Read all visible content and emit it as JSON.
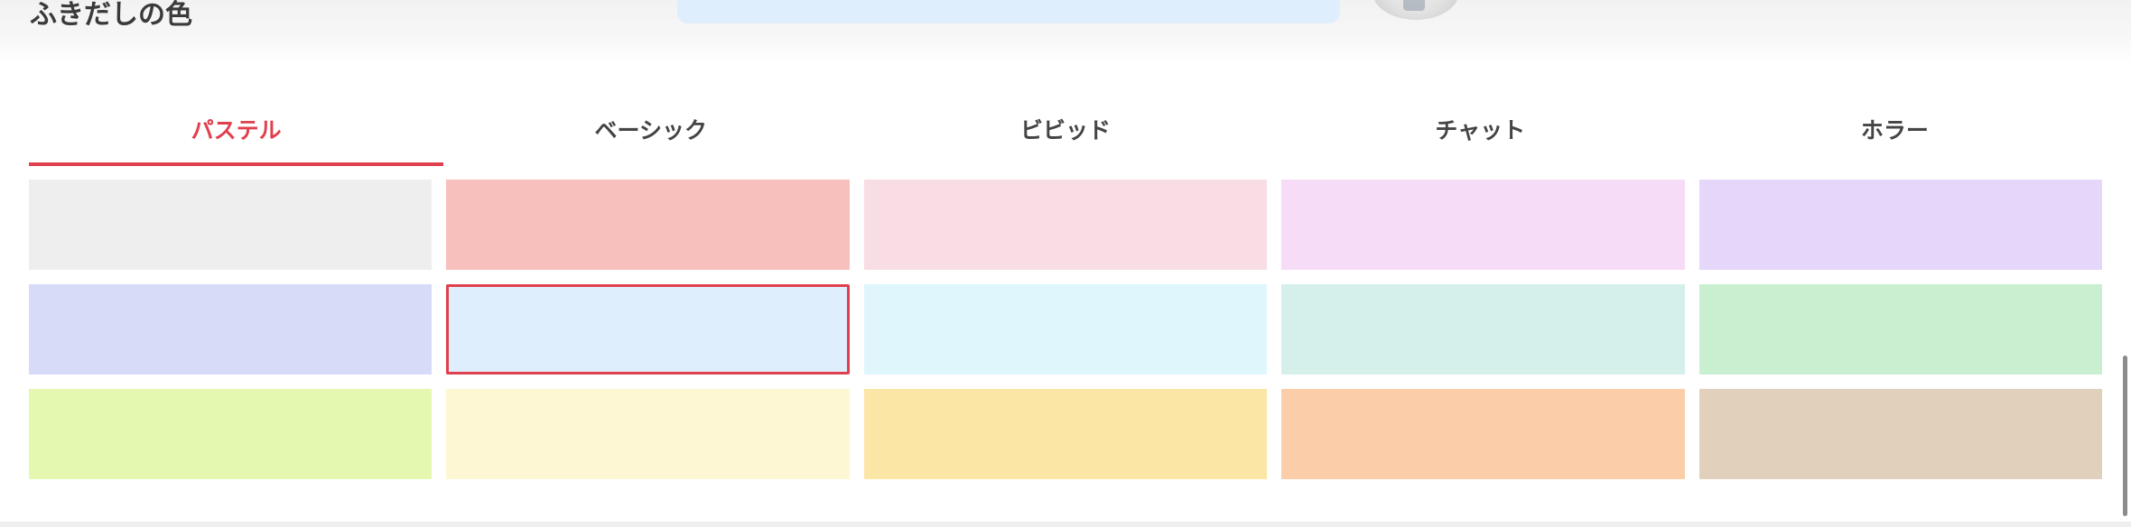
{
  "section": {
    "title": "ふきだしの色"
  },
  "tabs": [
    {
      "label": "パステル",
      "active": true
    },
    {
      "label": "ベーシック",
      "active": false
    },
    {
      "label": "ビビッド",
      "active": false
    },
    {
      "label": "チャット",
      "active": false
    },
    {
      "label": "ホラー",
      "active": false
    }
  ],
  "accent_color": "#e0404d",
  "preview_bubble_color": "#dfeefc",
  "swatches": [
    {
      "color": "#eeeeee",
      "selected": false
    },
    {
      "color": "#f7c0bd",
      "selected": false
    },
    {
      "color": "#f8dde4",
      "selected": false
    },
    {
      "color": "#f6dcf6",
      "selected": false
    },
    {
      "color": "#e5d7fa",
      "selected": false
    },
    {
      "color": "#d8dbf8",
      "selected": false
    },
    {
      "color": "#dfeefc",
      "selected": true
    },
    {
      "color": "#dff6fc",
      "selected": false
    },
    {
      "color": "#d5f0ea",
      "selected": false
    },
    {
      "color": "#c9eed0",
      "selected": false
    },
    {
      "color": "#e4f8b0",
      "selected": false
    },
    {
      "color": "#fdf7d3",
      "selected": false
    },
    {
      "color": "#fbe6a6",
      "selected": false
    },
    {
      "color": "#fbcea9",
      "selected": false
    },
    {
      "color": "#e1d1bc",
      "selected": false
    }
  ]
}
